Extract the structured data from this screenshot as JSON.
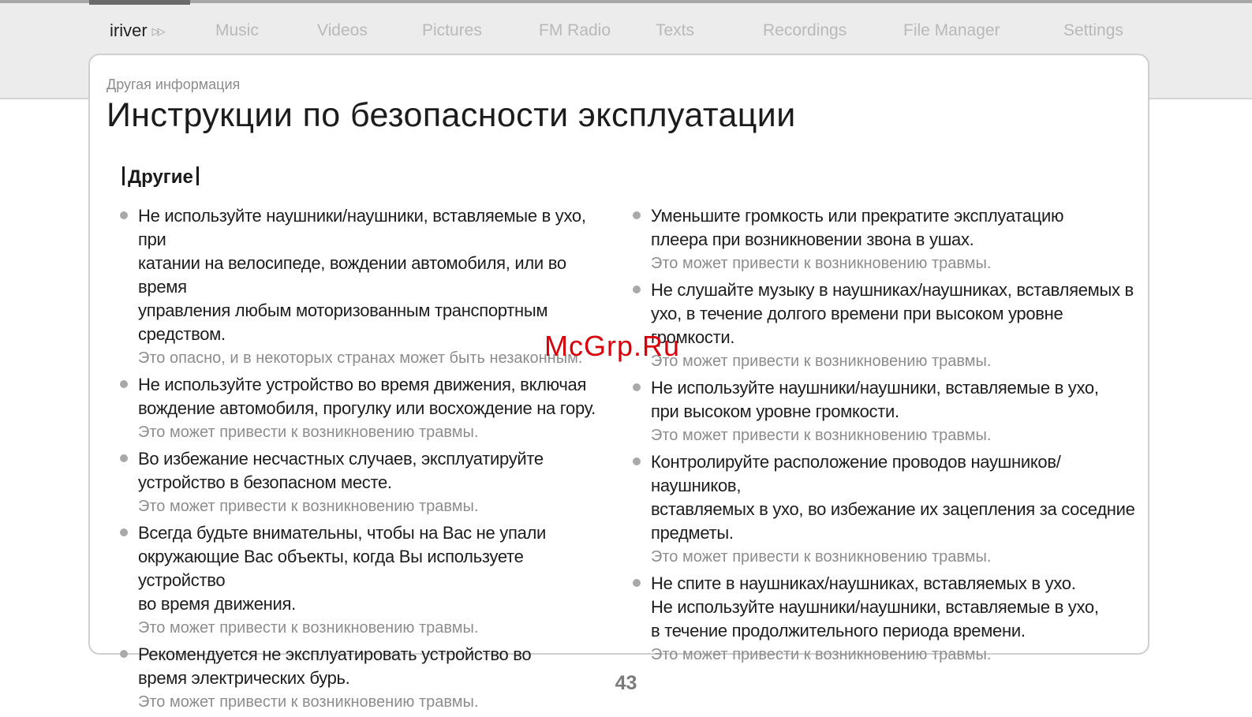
{
  "nav": {
    "brand": "iriver",
    "tabs": [
      "Music",
      "Videos",
      "Pictures",
      "FM Radio",
      "Texts",
      "Recordings",
      "File Manager",
      "Settings"
    ]
  },
  "page": {
    "subtitle": "Другая информация",
    "title": "Инструкции по безопасности эксплуатации",
    "section": "Другие",
    "page_number": "43"
  },
  "left_items": [
    {
      "text": "Не используйте наушники/наушники, вставляемые в ухо, при\nкатании на велосипеде, вождении автомобиля, или во время\nуправления любым моторизованным транспортным средством.",
      "note": "Это опасно, и в некоторых странах может быть незаконным."
    },
    {
      "text": "Не используйте устройство во время движения, включая\nвождение автомобиля, прогулку или восхождение на гору.",
      "note": "Это может привести к возникновению травмы."
    },
    {
      "text": "Во избежание несчастных случаев, эксплуатируйте\nустройство в безопасном месте.",
      "note": "Это может привести к возникновению травмы."
    },
    {
      "text": "Всегда будьте внимательны, чтобы на Вас не упали\nокружающие Вас объекты, когда Вы используете устройство\nво время движения.",
      "note": "Это может привести к возникновению травмы."
    },
    {
      "text": "Рекомендуется не эксплуатировать устройство во\nвремя электрических бурь.",
      "note": "Это может привести к возникновению травмы."
    }
  ],
  "right_items": [
    {
      "text": "Уменьшите громкость или прекратите эксплуатацию\nплеера при возникновении звона в ушах.",
      "note": "Это может привести к возникновению травмы."
    },
    {
      "text": "Не слушайте музыку в наушниках/наушниках, вставляемых в\nухо, в течение долгого времени при высоком уровне громкости.",
      "note": "Это может привести к возникновению травмы."
    },
    {
      "text": "Не используйте наушники/наушники, вставляемые в ухо,\nпри высоком уровне громкости.",
      "note": "Это может привести к возникновению травмы."
    },
    {
      "text": "Контролируйте расположение проводов наушников/наушников,\nвставляемых в ухо, во избежание их зацепления за соседние предметы.",
      "note": "Это может привести к возникновению травмы."
    },
    {
      "text": "Не спите в наушниках/наушниках, вставляемых в ухо.\nНе используйте наушники/наушники, вставляемые в ухо,\nв течение продолжительного периода времени.",
      "note": "Это может привести к возникновению травмы."
    }
  ],
  "watermark": "McGrp.Ru",
  "colors": {
    "accent": "#d9000b",
    "nav_background": "#ececec",
    "inactive_tab": "#b9b9b9",
    "note_text": "#8d8d8d"
  }
}
